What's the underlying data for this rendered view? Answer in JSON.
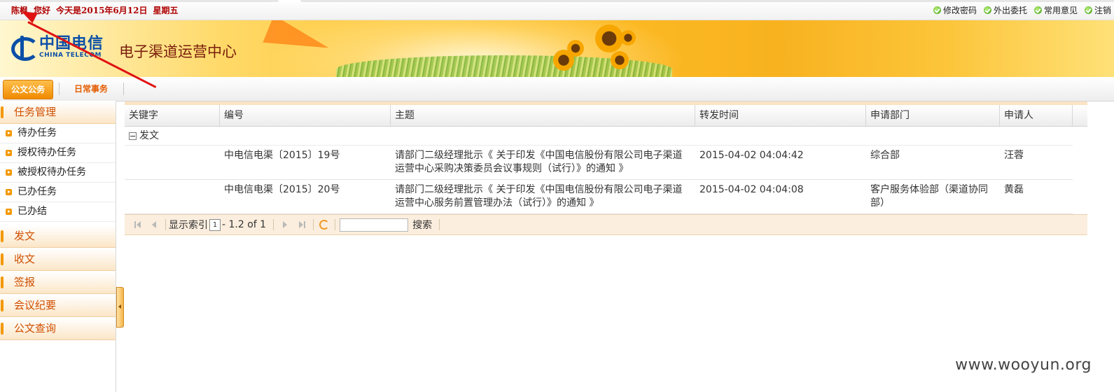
{
  "topbar": {
    "user": "陈枫",
    "greeting": "您好",
    "date_text": "今天是2015年6月12日",
    "weekday": "星期五",
    "links": [
      "修改密码",
      "外出委托",
      "常用意见",
      "注销"
    ]
  },
  "banner": {
    "logo_cn": "中国电信",
    "logo_en": "CHINA TELECOM",
    "title": "电子渠道运营中心"
  },
  "menu": {
    "tabs": [
      "公文公务",
      "日常事务"
    ]
  },
  "sidebar": {
    "task_group": "任务管理",
    "task_items": [
      "待办任务",
      "授权待办任务",
      "被授权待办任务",
      "已办任务",
      "已办结"
    ],
    "groups": [
      "发文",
      "收文",
      "签报",
      "会议纪要",
      "公文查询"
    ]
  },
  "grid": {
    "columns": [
      "关键字",
      "编号",
      "主题",
      "转发时间",
      "申请部门",
      "申请人"
    ],
    "group_label": "发文",
    "rows": [
      {
        "keyword": "",
        "number": "中电信电渠〔2015〕19号",
        "subject": "请部门二级经理批示《 关于印发《中国电信股份有限公司电子渠道运营中心采购决策委员会议事规则（试行）》的通知 》",
        "time": "2015-04-02 04:04:42",
        "dept": "综合部",
        "applicant": "汪蓉"
      },
      {
        "keyword": "",
        "number": "中电信电渠〔2015〕20号",
        "subject": "请部门二级经理批示《 关于印发《中国电信股份有限公司电子渠道运营中心服务前置管理办法（试行）》的通知 》",
        "time": "2015-04-02 04:04:08",
        "dept": "客户服务体验部（渠道协同部）",
        "applicant": "黄磊"
      }
    ]
  },
  "pager": {
    "index_label": "显示索引",
    "index_value": "1",
    "range_text": "- 1.2 of 1",
    "search_label": "搜索",
    "search_value": ""
  },
  "watermark": "www.wooyun.org",
  "colors": {
    "accent": "#f39800",
    "greeting": "#b00000",
    "sidebar_text": "#d04f00",
    "annotation_arrow": "#e01212"
  }
}
